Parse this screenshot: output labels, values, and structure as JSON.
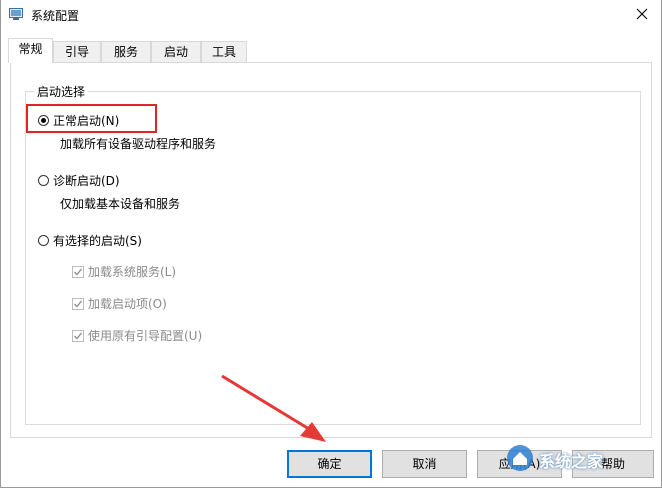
{
  "window": {
    "title": "系统配置",
    "icon": "system-config-icon"
  },
  "tabs": [
    {
      "label": "常规",
      "active": true
    },
    {
      "label": "引导",
      "active": false
    },
    {
      "label": "服务",
      "active": false
    },
    {
      "label": "启动",
      "active": false
    },
    {
      "label": "工具",
      "active": false
    }
  ],
  "startup": {
    "group_title": "启动选择",
    "normal": {
      "label": "正常启动(N)",
      "desc": "加载所有设备驱动程序和服务",
      "checked": true
    },
    "diagnostic": {
      "label": "诊断启动(D)",
      "desc": "仅加载基本设备和服务",
      "checked": false
    },
    "selective": {
      "label": "有选择的启动(S)",
      "checked": false,
      "options": [
        {
          "label": "加载系统服务(L)",
          "checked": true,
          "enabled": false
        },
        {
          "label": "加载启动项(O)",
          "checked": true,
          "enabled": false
        },
        {
          "label": "使用原有引导配置(U)",
          "checked": true,
          "enabled": false
        }
      ]
    }
  },
  "buttons": {
    "ok": "确定",
    "cancel": "取消",
    "apply": "应用(A)",
    "help": "帮助"
  },
  "annotations": {
    "highlight_color": "#e02424",
    "arrow_color": "#e53935"
  },
  "watermark": {
    "text": "系统之家"
  }
}
